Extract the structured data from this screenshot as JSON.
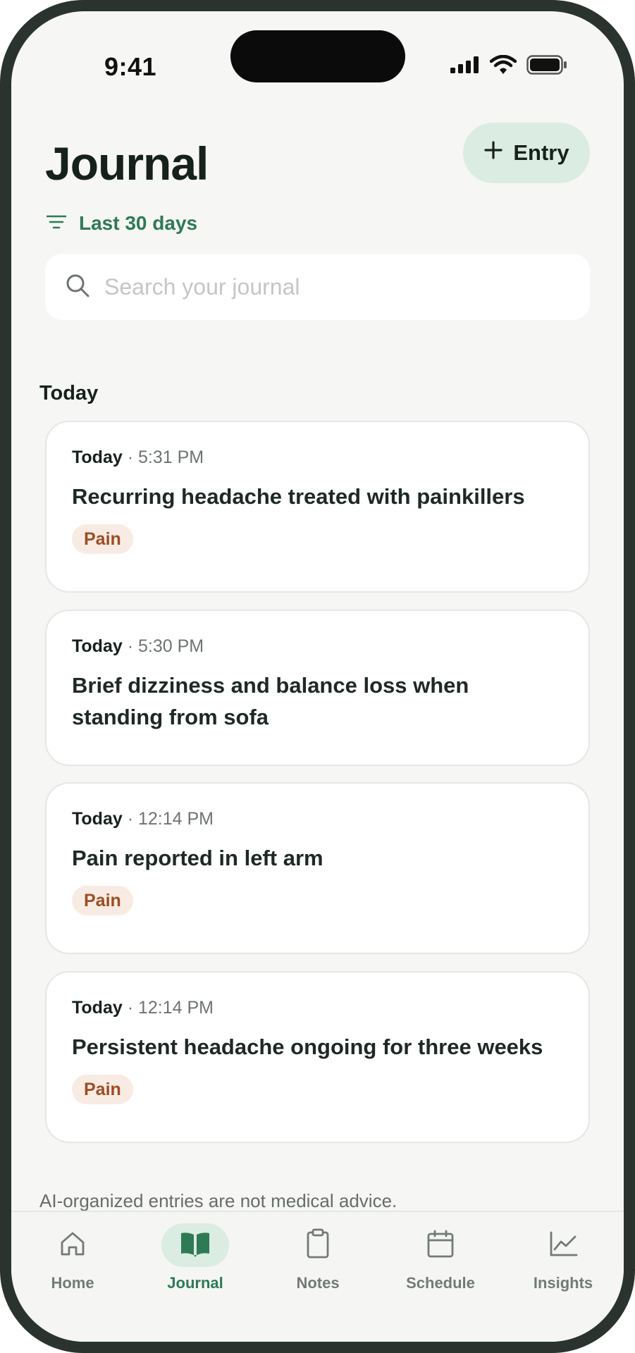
{
  "status_bar": {
    "time": "9:41"
  },
  "header": {
    "title": "Journal",
    "entry_button_label": "Entry",
    "filter_label": "Last 30 days"
  },
  "search": {
    "placeholder": "Search your journal",
    "value": ""
  },
  "section": {
    "title": "Today"
  },
  "entries": [
    {
      "day": "Today",
      "time": "5:31 PM",
      "title": "Recurring headache treated with painkillers",
      "tag": "Pain"
    },
    {
      "day": "Today",
      "time": "5:30 PM",
      "title": "Brief dizziness and balance loss when standing from sofa",
      "tag": ""
    },
    {
      "day": "Today",
      "time": "12:14 PM",
      "title": "Pain reported in left arm",
      "tag": "Pain"
    },
    {
      "day": "Today",
      "time": "12:14 PM",
      "title": "Persistent headache ongoing for three weeks",
      "tag": "Pain"
    }
  ],
  "meta_separator": "·",
  "disclaimer": "AI-organized entries are not medical advice.",
  "tabs": [
    {
      "label": "Home",
      "icon": "home-icon",
      "active": false
    },
    {
      "label": "Journal",
      "icon": "book-icon",
      "active": true
    },
    {
      "label": "Notes",
      "icon": "clipboard-icon",
      "active": false
    },
    {
      "label": "Schedule",
      "icon": "calendar-icon",
      "active": false
    },
    {
      "label": "Insights",
      "icon": "chart-icon",
      "active": false
    }
  ],
  "colors": {
    "accent": "#2e7a55",
    "accent_soft": "#dbece2",
    "tag_bg": "#f8ebe3",
    "tag_text": "#9a4e25",
    "background": "#f6f6f4"
  }
}
